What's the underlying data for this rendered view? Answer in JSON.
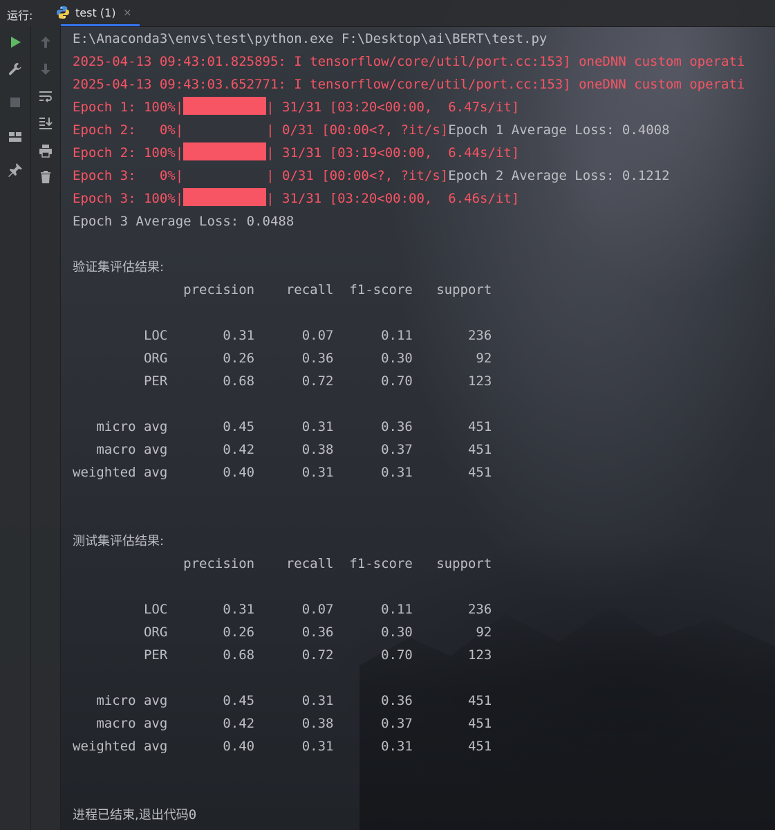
{
  "tabbar": {
    "run_label": "运行:",
    "tab_title": "test (1)",
    "tab_close": "×"
  },
  "toolbar": {
    "left": [
      "run-icon",
      "wrench-icon",
      "stop-icon",
      "layout-icon",
      "pin-icon"
    ],
    "right": [
      "arrow-up-icon",
      "arrow-down-icon",
      "soft-wrap-icon",
      "scroll-to-end-icon",
      "print-icon",
      "trash-icon"
    ],
    "accent_run": "#5fb865"
  },
  "console": {
    "cmd_line": "E:\\Anaconda3\\envs\\test\\python.exe F:\\Desktop\\ai\\BERT\\test.py",
    "log_lines": [
      "2025-04-13 09:43:01.825895: I tensorflow/core/util/port.cc:153] oneDNN custom operati",
      "2025-04-13 09:43:03.652771: I tensorflow/core/util/port.cc:153] oneDNN custom operati"
    ],
    "progress": [
      {
        "prefix": "Epoch 1: 100%|",
        "fill": 1.0,
        "suffix": "| 31/31 [03:20<00:00,  6.47s/it]",
        "extra": ""
      },
      {
        "prefix": "Epoch 2:   0%|",
        "fill": 0.0,
        "suffix": "| 0/31 [00:00<?, ?it/s]",
        "extra": "Epoch 1 Average Loss: 0.4008"
      },
      {
        "prefix": "Epoch 2: 100%|",
        "fill": 1.0,
        "suffix": "| 31/31 [03:19<00:00,  6.44s/it]",
        "extra": ""
      },
      {
        "prefix": "Epoch 3:   0%|",
        "fill": 0.0,
        "suffix": "| 0/31 [00:00<?, ?it/s]",
        "extra": "Epoch 2 Average Loss: 0.1212"
      },
      {
        "prefix": "Epoch 3: 100%|",
        "fill": 1.0,
        "suffix": "| 31/31 [03:20<00:00,  6.46s/it]",
        "extra": ""
      }
    ],
    "final_loss": "Epoch 3 Average Loss: 0.0488",
    "reports": [
      {
        "title": "验证集评估结果:",
        "header": "              precision    recall  f1-score   support",
        "rows": [
          "         LOC       0.31      0.07      0.11       236",
          "         ORG       0.26      0.36      0.30        92",
          "         PER       0.68      0.72      0.70       123"
        ],
        "avgs": [
          "   micro avg       0.45      0.31      0.36       451",
          "   macro avg       0.42      0.38      0.37       451",
          "weighted avg       0.40      0.31      0.31       451"
        ]
      },
      {
        "title": "测试集评估结果:",
        "header": "              precision    recall  f1-score   support",
        "rows": [
          "         LOC       0.31      0.07      0.11       236",
          "         ORG       0.26      0.36      0.30        92",
          "         PER       0.68      0.72      0.70       123"
        ],
        "avgs": [
          "   micro avg       0.45      0.31      0.36       451",
          "   macro avg       0.42      0.38      0.37       451",
          "weighted avg       0.40      0.31      0.31       451"
        ]
      }
    ],
    "exit_msg": "进程已结束,退出代码",
    "exit_code": "0"
  }
}
